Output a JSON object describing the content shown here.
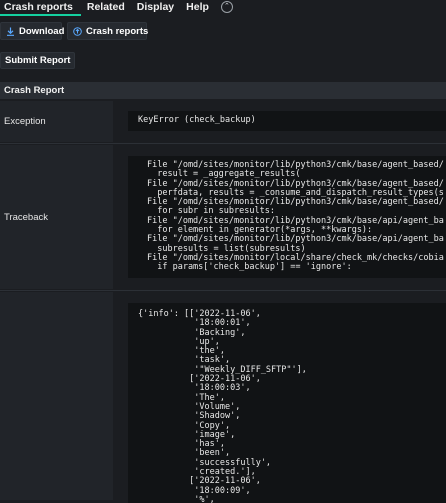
{
  "menubar": {
    "items": [
      "Crash reports",
      "Related",
      "Display",
      "Help"
    ],
    "collapse_icon": "chevron-up-icon"
  },
  "toolbar": {
    "download_label": "Download",
    "crash_reports_label": "Crash reports",
    "submit_label": "Submit Report"
  },
  "report": {
    "section_title": "Crash Report",
    "exception_label": "Exception",
    "exception_value": "KeyError (check_backup)",
    "traceback_label": "Traceback",
    "traceback_lines": [
      "File \"/omd/sites/monitor/lib/python3/cmk/base/agent_based/",
      "  result = _aggregate_results(",
      "File \"/omd/sites/monitor/lib/python3/cmk/base/agent_based/",
      "  perfdata, results = _consume_and_dispatch_result_types(s",
      "File \"/omd/sites/monitor/lib/python3/cmk/base/agent_based/",
      "  for subr in subresults:",
      "File \"/omd/sites/monitor/lib/python3/cmk/base/api/agent_ba",
      "  for element in generator(*args, **kwargs):",
      "File \"/omd/sites/monitor/lib/python3/cmk/base/api/agent_ba",
      "  subresults = list(subresults)",
      "File \"/omd/sites/monitor/local/share/check_mk/checks/cobia",
      "  if params['check_backup'] == 'ignore':"
    ],
    "info_lines": [
      "{'info': [['2022-11-06',",
      "           '18:00:01',",
      "           'Backing',",
      "           'up',",
      "           'the',",
      "           'task',",
      "           '\"Weekly_DIFF_SFTP\"'],",
      "          ['2022-11-06',",
      "           '18:00:03',",
      "           'The',",
      "           'Volume',",
      "           'Shadow',",
      "           'Copy',",
      "           'image',",
      "           'has',",
      "           'been',",
      "           'successfully',",
      "           'created.'],",
      "          ['2022-11-06',",
      "           '18:00:09',",
      "           '%',"
    ]
  },
  "colors": {
    "accent": "#15d1a0",
    "background": "#1b1d21",
    "code_background": "#111315"
  }
}
